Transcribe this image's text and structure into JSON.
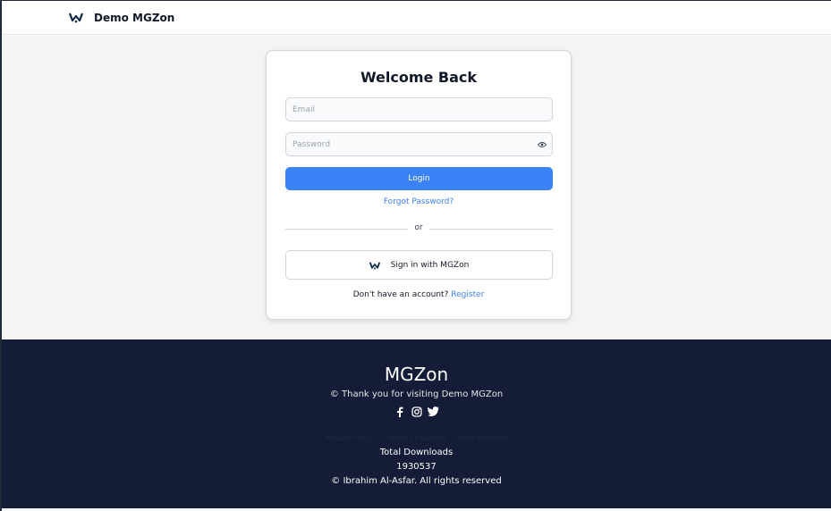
{
  "header": {
    "logo_icon": "mgzon-logo-icon",
    "brand_name": "Demo MGZon"
  },
  "login_card": {
    "title": "Welcome Back",
    "email": {
      "placeholder": "Email",
      "value": ""
    },
    "password": {
      "placeholder": "Password",
      "value": ""
    },
    "toggle_visibility_icon": "eye-icon",
    "login_label": "Login",
    "forgot_label": "Forgot Password?",
    "divider_text": "or",
    "oauth_label": "Sign in with MGZon",
    "register_prompt": "Don't have an account?",
    "register_label": "Register"
  },
  "footer": {
    "title": "MGZon",
    "thanks": "© Thank you for visiting Demo MGZon",
    "social_icons": [
      "facebook-icon",
      "instagram-icon",
      "twitter-icon"
    ],
    "links": [
      "Privacy Policy",
      "Terms of Service",
      "Data Deletion"
    ],
    "downloads_label": "Total Downloads",
    "downloads_count": "1930537",
    "copyright": "© Ibrahim Al-Asfar. All rights reserved"
  },
  "colors": {
    "primary": "#3b82f6",
    "footer_bg": "#141c37",
    "page_bg": "#f3f4f6"
  }
}
